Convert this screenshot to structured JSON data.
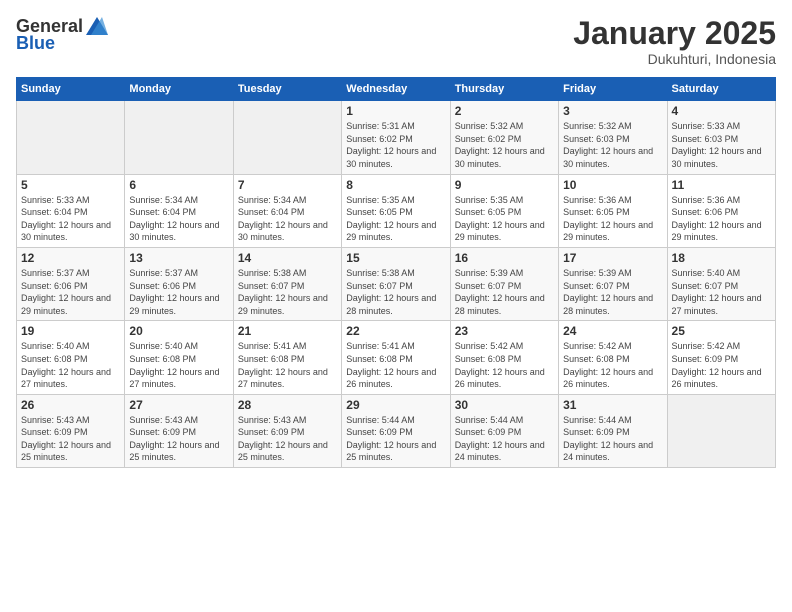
{
  "logo": {
    "general": "General",
    "blue": "Blue"
  },
  "header": {
    "title": "January 2025",
    "subtitle": "Dukuhturi, Indonesia"
  },
  "weekdays": [
    "Sunday",
    "Monday",
    "Tuesday",
    "Wednesday",
    "Thursday",
    "Friday",
    "Saturday"
  ],
  "weeks": [
    [
      {
        "day": "",
        "sunrise": "",
        "sunset": "",
        "daylight": ""
      },
      {
        "day": "",
        "sunrise": "",
        "sunset": "",
        "daylight": ""
      },
      {
        "day": "",
        "sunrise": "",
        "sunset": "",
        "daylight": ""
      },
      {
        "day": "1",
        "sunrise": "Sunrise: 5:31 AM",
        "sunset": "Sunset: 6:02 PM",
        "daylight": "Daylight: 12 hours and 30 minutes."
      },
      {
        "day": "2",
        "sunrise": "Sunrise: 5:32 AM",
        "sunset": "Sunset: 6:02 PM",
        "daylight": "Daylight: 12 hours and 30 minutes."
      },
      {
        "day": "3",
        "sunrise": "Sunrise: 5:32 AM",
        "sunset": "Sunset: 6:03 PM",
        "daylight": "Daylight: 12 hours and 30 minutes."
      },
      {
        "day": "4",
        "sunrise": "Sunrise: 5:33 AM",
        "sunset": "Sunset: 6:03 PM",
        "daylight": "Daylight: 12 hours and 30 minutes."
      }
    ],
    [
      {
        "day": "5",
        "sunrise": "Sunrise: 5:33 AM",
        "sunset": "Sunset: 6:04 PM",
        "daylight": "Daylight: 12 hours and 30 minutes."
      },
      {
        "day": "6",
        "sunrise": "Sunrise: 5:34 AM",
        "sunset": "Sunset: 6:04 PM",
        "daylight": "Daylight: 12 hours and 30 minutes."
      },
      {
        "day": "7",
        "sunrise": "Sunrise: 5:34 AM",
        "sunset": "Sunset: 6:04 PM",
        "daylight": "Daylight: 12 hours and 30 minutes."
      },
      {
        "day": "8",
        "sunrise": "Sunrise: 5:35 AM",
        "sunset": "Sunset: 6:05 PM",
        "daylight": "Daylight: 12 hours and 29 minutes."
      },
      {
        "day": "9",
        "sunrise": "Sunrise: 5:35 AM",
        "sunset": "Sunset: 6:05 PM",
        "daylight": "Daylight: 12 hours and 29 minutes."
      },
      {
        "day": "10",
        "sunrise": "Sunrise: 5:36 AM",
        "sunset": "Sunset: 6:05 PM",
        "daylight": "Daylight: 12 hours and 29 minutes."
      },
      {
        "day": "11",
        "sunrise": "Sunrise: 5:36 AM",
        "sunset": "Sunset: 6:06 PM",
        "daylight": "Daylight: 12 hours and 29 minutes."
      }
    ],
    [
      {
        "day": "12",
        "sunrise": "Sunrise: 5:37 AM",
        "sunset": "Sunset: 6:06 PM",
        "daylight": "Daylight: 12 hours and 29 minutes."
      },
      {
        "day": "13",
        "sunrise": "Sunrise: 5:37 AM",
        "sunset": "Sunset: 6:06 PM",
        "daylight": "Daylight: 12 hours and 29 minutes."
      },
      {
        "day": "14",
        "sunrise": "Sunrise: 5:38 AM",
        "sunset": "Sunset: 6:07 PM",
        "daylight": "Daylight: 12 hours and 29 minutes."
      },
      {
        "day": "15",
        "sunrise": "Sunrise: 5:38 AM",
        "sunset": "Sunset: 6:07 PM",
        "daylight": "Daylight: 12 hours and 28 minutes."
      },
      {
        "day": "16",
        "sunrise": "Sunrise: 5:39 AM",
        "sunset": "Sunset: 6:07 PM",
        "daylight": "Daylight: 12 hours and 28 minutes."
      },
      {
        "day": "17",
        "sunrise": "Sunrise: 5:39 AM",
        "sunset": "Sunset: 6:07 PM",
        "daylight": "Daylight: 12 hours and 28 minutes."
      },
      {
        "day": "18",
        "sunrise": "Sunrise: 5:40 AM",
        "sunset": "Sunset: 6:07 PM",
        "daylight": "Daylight: 12 hours and 27 minutes."
      }
    ],
    [
      {
        "day": "19",
        "sunrise": "Sunrise: 5:40 AM",
        "sunset": "Sunset: 6:08 PM",
        "daylight": "Daylight: 12 hours and 27 minutes."
      },
      {
        "day": "20",
        "sunrise": "Sunrise: 5:40 AM",
        "sunset": "Sunset: 6:08 PM",
        "daylight": "Daylight: 12 hours and 27 minutes."
      },
      {
        "day": "21",
        "sunrise": "Sunrise: 5:41 AM",
        "sunset": "Sunset: 6:08 PM",
        "daylight": "Daylight: 12 hours and 27 minutes."
      },
      {
        "day": "22",
        "sunrise": "Sunrise: 5:41 AM",
        "sunset": "Sunset: 6:08 PM",
        "daylight": "Daylight: 12 hours and 26 minutes."
      },
      {
        "day": "23",
        "sunrise": "Sunrise: 5:42 AM",
        "sunset": "Sunset: 6:08 PM",
        "daylight": "Daylight: 12 hours and 26 minutes."
      },
      {
        "day": "24",
        "sunrise": "Sunrise: 5:42 AM",
        "sunset": "Sunset: 6:08 PM",
        "daylight": "Daylight: 12 hours and 26 minutes."
      },
      {
        "day": "25",
        "sunrise": "Sunrise: 5:42 AM",
        "sunset": "Sunset: 6:09 PM",
        "daylight": "Daylight: 12 hours and 26 minutes."
      }
    ],
    [
      {
        "day": "26",
        "sunrise": "Sunrise: 5:43 AM",
        "sunset": "Sunset: 6:09 PM",
        "daylight": "Daylight: 12 hours and 25 minutes."
      },
      {
        "day": "27",
        "sunrise": "Sunrise: 5:43 AM",
        "sunset": "Sunset: 6:09 PM",
        "daylight": "Daylight: 12 hours and 25 minutes."
      },
      {
        "day": "28",
        "sunrise": "Sunrise: 5:43 AM",
        "sunset": "Sunset: 6:09 PM",
        "daylight": "Daylight: 12 hours and 25 minutes."
      },
      {
        "day": "29",
        "sunrise": "Sunrise: 5:44 AM",
        "sunset": "Sunset: 6:09 PM",
        "daylight": "Daylight: 12 hours and 25 minutes."
      },
      {
        "day": "30",
        "sunrise": "Sunrise: 5:44 AM",
        "sunset": "Sunset: 6:09 PM",
        "daylight": "Daylight: 12 hours and 24 minutes."
      },
      {
        "day": "31",
        "sunrise": "Sunrise: 5:44 AM",
        "sunset": "Sunset: 6:09 PM",
        "daylight": "Daylight: 12 hours and 24 minutes."
      },
      {
        "day": "",
        "sunrise": "",
        "sunset": "",
        "daylight": ""
      }
    ]
  ]
}
